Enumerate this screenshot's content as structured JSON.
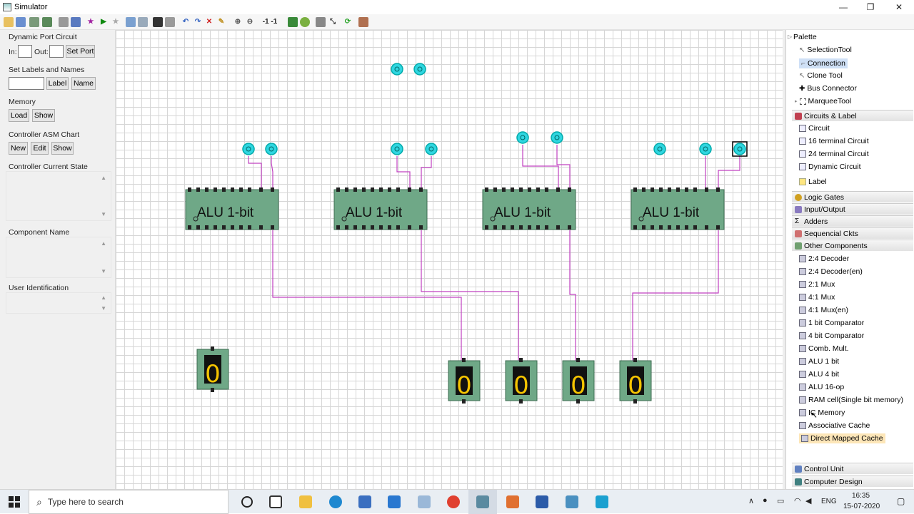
{
  "window": {
    "title": "Simulator",
    "minimize": "—",
    "maximize": "❐",
    "close": "✕"
  },
  "left_panel": {
    "dynamic_port": {
      "title": "Dynamic Port Circuit",
      "in_label": "In:",
      "out_label": "Out:",
      "in_value": "",
      "out_value": "",
      "set_port": "Set Port"
    },
    "labels": {
      "title": "Set Labels and Names",
      "value": "",
      "label_btn": "Label",
      "name_btn": "Name"
    },
    "memory": {
      "title": "Memory",
      "load": "Load",
      "show": "Show"
    },
    "asm": {
      "title": "Controller ASM Chart",
      "new": "New",
      "edit": "Edit",
      "show": "Show"
    },
    "current_state": {
      "title": "Controller Current State"
    },
    "component_name": {
      "title": "Component Name"
    },
    "user_id": {
      "title": "User Identification"
    }
  },
  "canvas": {
    "alu_label": "ALU 1-bit",
    "display_value": "0"
  },
  "palette": {
    "title": "Palette",
    "tools": [
      "SelectionTool",
      "Connection",
      "Clone Tool",
      "Bus Connector",
      "MarqueeTool"
    ],
    "selected_tool": "Connection",
    "circuits_group": "Circuits & Label",
    "circuits": [
      "Circuit",
      "16 terminal Circuit",
      "24 terminal Circuit",
      "Dynamic Circuit"
    ],
    "label_item": "Label",
    "groups": [
      "Logic Gates",
      "Input/Output",
      "Adders",
      "Sequencial Ckts",
      "Other Components"
    ],
    "other_components": [
      "2:4 Decoder",
      "2:4 Decoder(en)",
      "2:1 Mux",
      "4:1 Mux",
      "4:1 Mux(en)",
      "1 bit Comparator",
      "4 bit Comparator",
      "Comb. Mult.",
      "ALU 1 bit",
      "ALU 4 bit",
      "ALU 16-op",
      "RAM cell(Single bit memory)",
      "IC Memory",
      "Associative Cache",
      "Direct Mapped Cache"
    ],
    "selected_component": "Direct Mapped Cache",
    "bottom_groups": [
      "Control Unit",
      "Computer Design"
    ]
  },
  "taskbar": {
    "search_placeholder": "Type here to search",
    "lang": "ENG",
    "time": "16:35",
    "date": "15-07-2020"
  }
}
